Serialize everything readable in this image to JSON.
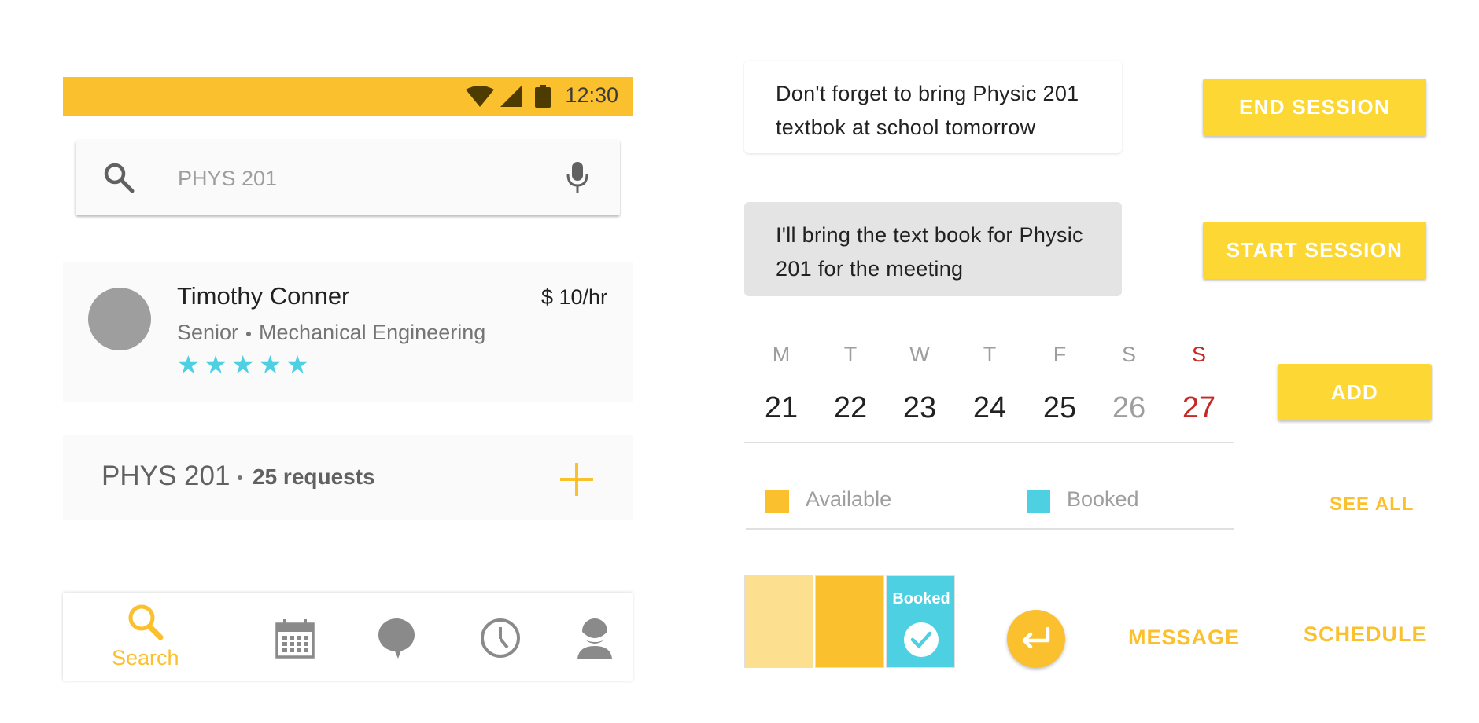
{
  "colors": {
    "accent": "#fbc02d",
    "accent_light": "#fde08f",
    "button": "#fdd835",
    "booked": "#4dd0e1",
    "weekend_red": "#c62828",
    "muted": "#9e9e9e"
  },
  "status_bar": {
    "time": "12:30",
    "icons": [
      "wifi-icon",
      "signal-icon",
      "battery-icon"
    ]
  },
  "search": {
    "value": "PHYS 201",
    "icon": "search-icon",
    "voice_icon": "mic-icon"
  },
  "tutor": {
    "name": "Timothy Conner",
    "rate": "$ 10/hr",
    "year": "Senior",
    "major": "Mechanical Engineering",
    "rating": 5,
    "rating_max": 5,
    "stars": "★★★★★"
  },
  "course": {
    "code": "PHYS 201",
    "requests": "25 requests",
    "add_icon": "plus-icon"
  },
  "bottom_nav": {
    "items": [
      {
        "id": "search",
        "label": "Search",
        "icon": "search-icon",
        "active": true
      },
      {
        "id": "calendar",
        "icon": "calendar-icon"
      },
      {
        "id": "messages",
        "icon": "chat-bubble-icon"
      },
      {
        "id": "history",
        "icon": "clock-icon"
      },
      {
        "id": "profile",
        "icon": "profile-icon"
      }
    ]
  },
  "messages": [
    {
      "text": "Don't forget to bring Physic 201 textbok at school tomorrow",
      "style": "incoming"
    },
    {
      "text": "I'll bring the text book for Physic 201 for the meeting",
      "style": "outgoing"
    }
  ],
  "buttons": {
    "end_session": "END SESSION",
    "start_session": "START SESSION",
    "add": "ADD",
    "see_all": "SEE ALL",
    "message": "MESSAGE",
    "schedule": "SCHEDULE"
  },
  "calendar": {
    "days": [
      "M",
      "T",
      "W",
      "T",
      "F",
      "S",
      "S"
    ],
    "dates": [
      "21",
      "22",
      "23",
      "24",
      "25",
      "26",
      "27"
    ]
  },
  "legend": {
    "available": "Available",
    "booked": "Booked"
  },
  "slots": {
    "booked_label": "Booked",
    "check_icon": "check-icon"
  },
  "fab": {
    "icon": "return-arrow-icon"
  }
}
